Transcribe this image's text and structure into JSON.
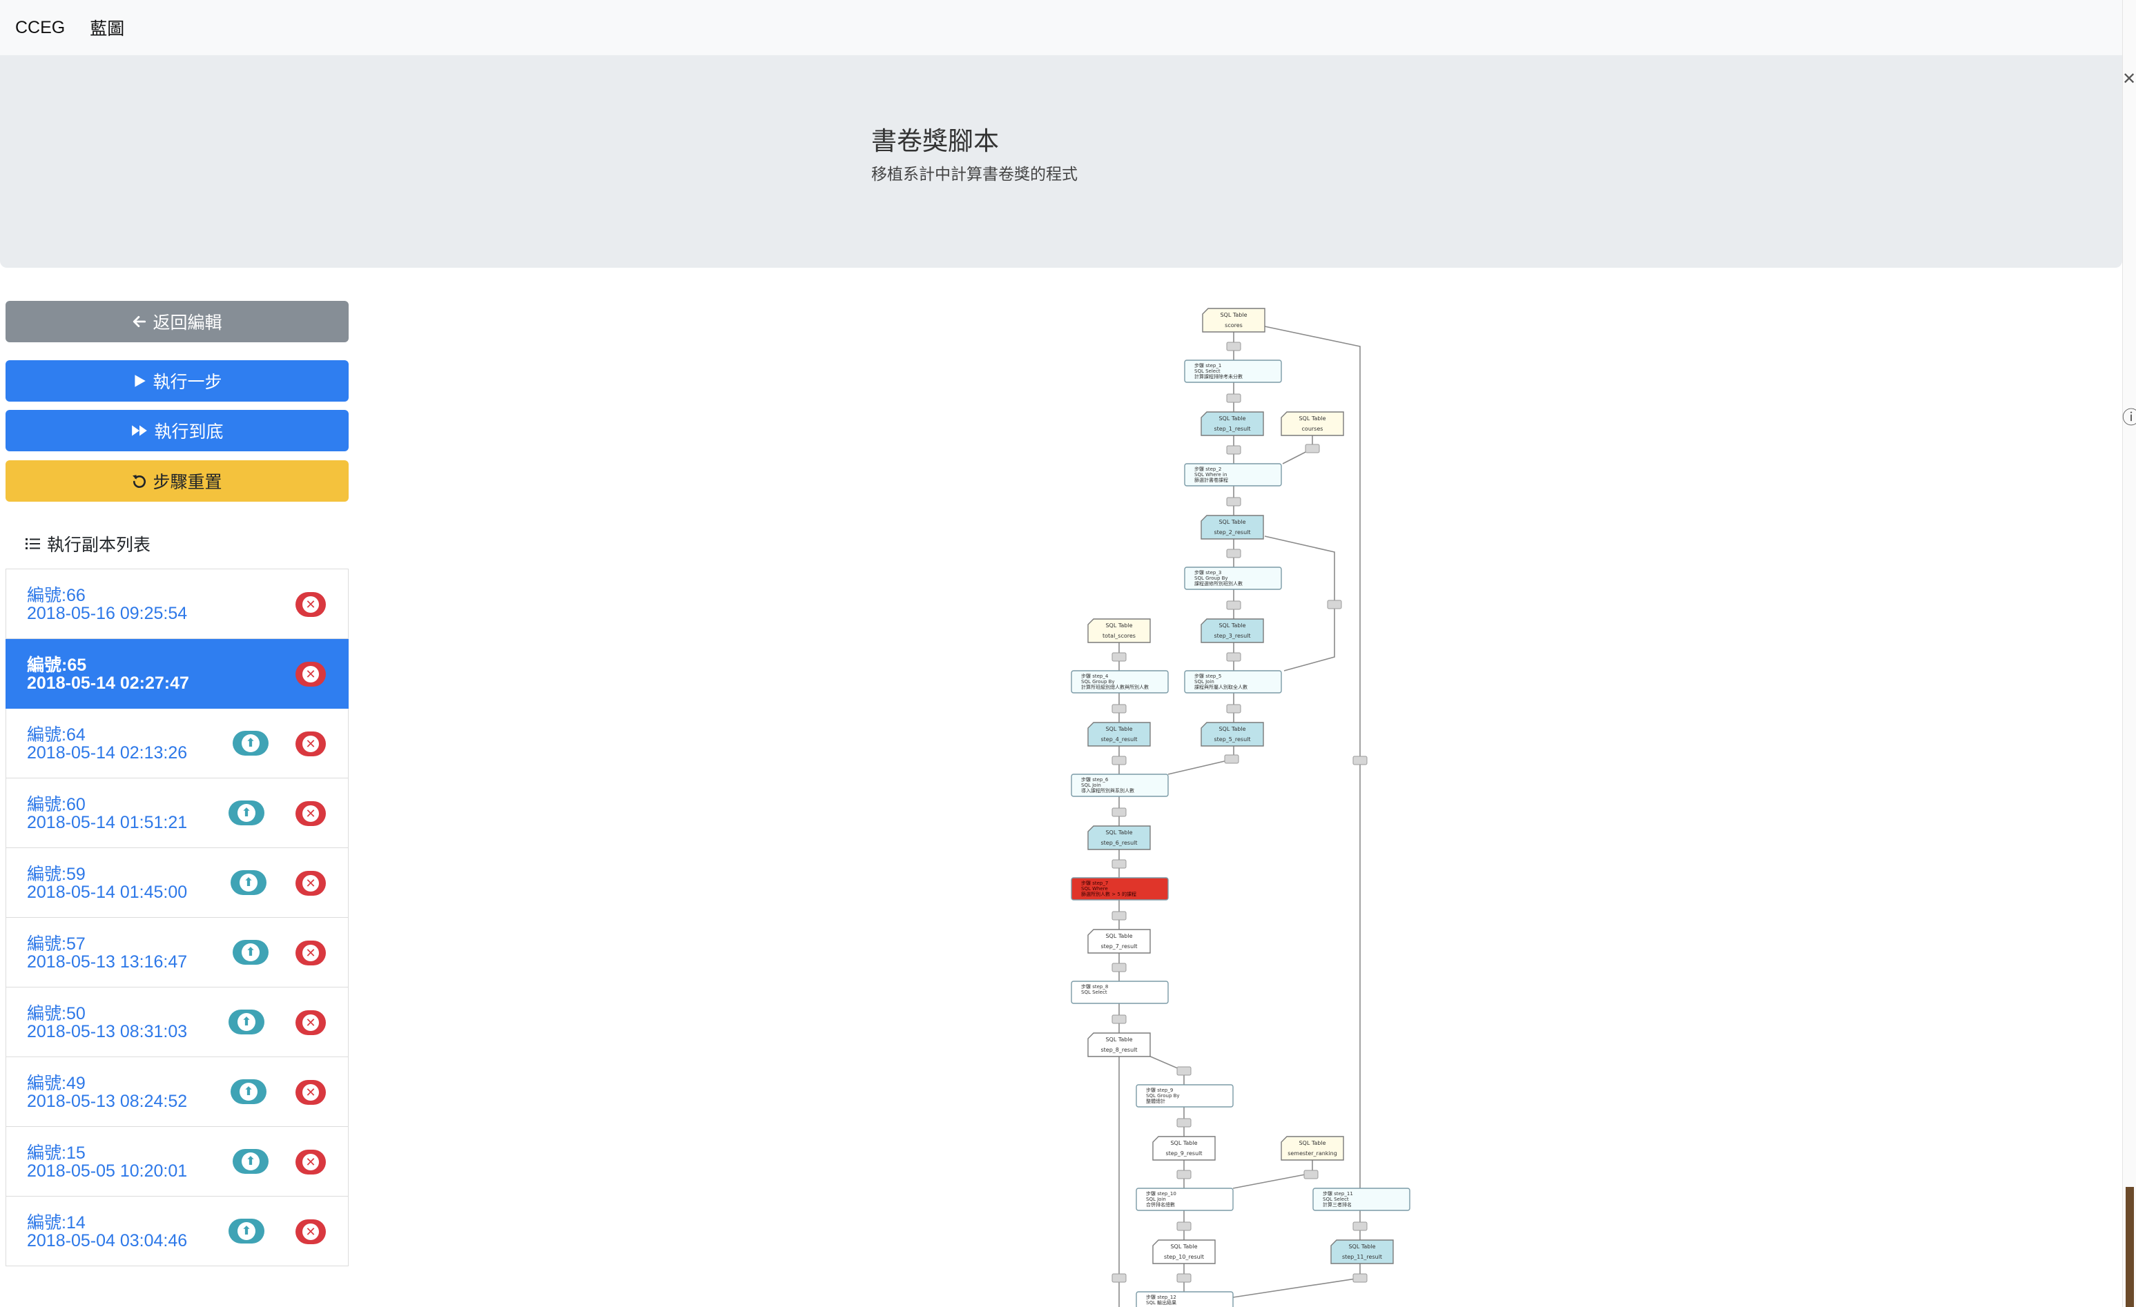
{
  "navbar": {
    "brand": "CCEG",
    "link": "藍圖"
  },
  "header": {
    "title": "書卷獎腳本",
    "subtitle": "移植系計中計算書卷獎的程式"
  },
  "buttons": {
    "back": "返回編輯",
    "step": "執行一步",
    "run_all": "執行到底",
    "reset": "步驟重置"
  },
  "list_title": "執行副本列表",
  "instances": [
    {
      "num": "編號:66",
      "time": "2018-05-16 09:25:54",
      "upload": false,
      "active": false
    },
    {
      "num": "編號:65",
      "time": "2018-05-14 02:27:47",
      "upload": false,
      "active": true
    },
    {
      "num": "編號:64",
      "time": "2018-05-14 02:13:26",
      "upload": true,
      "active": false
    },
    {
      "num": "編號:60",
      "time": "2018-05-14 01:51:21",
      "upload": true,
      "active": false
    },
    {
      "num": "編號:59",
      "time": "2018-05-14 01:45:00",
      "upload": true,
      "active": false
    },
    {
      "num": "編號:57",
      "time": "2018-05-13 13:16:47",
      "upload": true,
      "active": false
    },
    {
      "num": "編號:50",
      "time": "2018-05-13 08:31:03",
      "upload": true,
      "active": false
    },
    {
      "num": "編號:49",
      "time": "2018-05-13 08:24:52",
      "upload": true,
      "active": false
    },
    {
      "num": "編號:15",
      "time": "2018-05-05 10:20:01",
      "upload": true,
      "active": false
    },
    {
      "num": "編號:14",
      "time": "2018-05-04 03:04:46",
      "upload": true,
      "active": false
    }
  ],
  "diagram": {
    "colors": {
      "table_source": "#fffbe6",
      "table_result": "#bde2ea",
      "step": "#f2fcfd",
      "error": "#e0352a",
      "connector": "#d6d6d6"
    },
    "tables": [
      {
        "id": "scores",
        "kind": "source",
        "l1": "SQL Table",
        "l2": "scores"
      },
      {
        "id": "t1",
        "kind": "result",
        "l1": "SQL Table",
        "l2": "step_1_result"
      },
      {
        "id": "courses",
        "kind": "source",
        "l1": "SQL Table",
        "l2": "courses"
      },
      {
        "id": "t2",
        "kind": "result",
        "l1": "SQL Table",
        "l2": "step_2_result"
      },
      {
        "id": "t3",
        "kind": "result",
        "l1": "SQL Table",
        "l2": "step_3_result"
      },
      {
        "id": "total",
        "kind": "source",
        "l1": "SQL Table",
        "l2": "total_scores"
      },
      {
        "id": "t4",
        "kind": "result",
        "l1": "SQL Table",
        "l2": "step_4_result"
      },
      {
        "id": "t5",
        "kind": "result",
        "l1": "SQL Table",
        "l2": "step_5_result"
      },
      {
        "id": "t6",
        "kind": "result",
        "l1": "SQL Table",
        "l2": "step_6_result"
      },
      {
        "id": "t7",
        "kind": "plain",
        "l1": "SQL Table",
        "l2": "step_7_result"
      },
      {
        "id": "t8",
        "kind": "plain",
        "l1": "SQL Table",
        "l2": "step_8_result"
      },
      {
        "id": "t9",
        "kind": "plain",
        "l1": "SQL Table",
        "l2": "step_9_result"
      },
      {
        "id": "sem",
        "kind": "source",
        "l1": "SQL Table",
        "l2": "semester_ranking"
      },
      {
        "id": "t10",
        "kind": "plain",
        "l1": "SQL Table",
        "l2": "step_10_result"
      },
      {
        "id": "t11",
        "kind": "result",
        "l1": "SQL Table",
        "l2": "step_11_result"
      }
    ],
    "steps": [
      {
        "id": "s1",
        "l1": "步驟 step_1",
        "l2": "SQL Select",
        "l3": "計算課程排除考未分數",
        "state": "normal"
      },
      {
        "id": "s2",
        "l1": "步驟 step_2",
        "l2": "SQL Where in",
        "l3": "篩選計書卷課程",
        "state": "normal"
      },
      {
        "id": "s3",
        "l1": "步驟 step_3",
        "l2": "SQL Group By",
        "l3": "課程選修所別班別人數",
        "state": "normal"
      },
      {
        "id": "s4",
        "l1": "步驟 step_4",
        "l2": "SQL Group By",
        "l3": "計算所班級別總人數與所別人數",
        "state": "normal"
      },
      {
        "id": "s5",
        "l1": "步驟 step_5",
        "l2": "SQL Join",
        "l3": "課程與所屬人別取全人數",
        "state": "normal"
      },
      {
        "id": "s6",
        "l1": "步驟 step_6",
        "l2": "SQL Join",
        "l3": "導入課程所別與系別人數",
        "state": "normal"
      },
      {
        "id": "s7",
        "l1": "步驟 step_7",
        "l2": "SQL Where",
        "l3": "篩選所別人數 > 5 的課程",
        "state": "error"
      },
      {
        "id": "s8",
        "l1": "步驟 step_8",
        "l2": "SQL Select",
        "l3": "",
        "state": "plain"
      },
      {
        "id": "s9",
        "l1": "步驟 step_9",
        "l2": "SQL Group By",
        "l3": "整體總計",
        "state": "plain"
      },
      {
        "id": "s10",
        "l1": "步驟 step_10",
        "l2": "SQL Join",
        "l3": "合併排名總數",
        "state": "plain"
      },
      {
        "id": "s11",
        "l1": "步驟 step_11",
        "l2": "SQL Select",
        "l3": "計算三者排名",
        "state": "normal"
      },
      {
        "id": "s12",
        "l1": "步驟 step_12",
        "l2": "SQL 輸出結果",
        "l3": "",
        "state": "plain"
      }
    ]
  }
}
